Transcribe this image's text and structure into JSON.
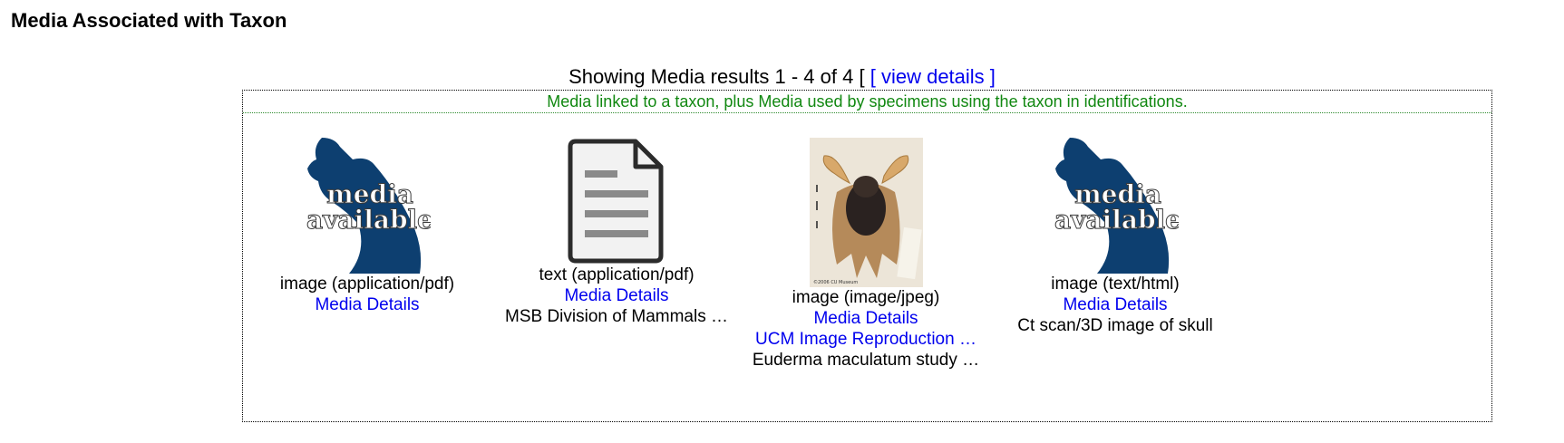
{
  "heading": "Media Associated with Taxon",
  "results": {
    "prefix": "Showing Media results 1 - 4 of 4",
    "bracket_open": "[",
    "view_details": "[ view details ]"
  },
  "note": "Media linked to a taxon, plus Media used by specimens using the taxon in identifications.",
  "items": [
    {
      "thumb_text_1": "media",
      "thumb_text_2": "available",
      "type": "image (application/pdf)",
      "details_link": "Media Details"
    },
    {
      "thumb_icon": "document-icon",
      "type": "text (application/pdf)",
      "details_link": "Media Details",
      "description": "MSB Division of Mammals …"
    },
    {
      "thumb_icon": "bat-specimen-photo",
      "thumb_caption": "©2006 CU Museum",
      "type": "image (image/jpeg)",
      "details_link": "Media Details",
      "extra_link": "UCM Image Reproduction …",
      "description": "Euderma maculatum study …"
    },
    {
      "thumb_text_1": "media",
      "thumb_text_2": "available",
      "type": "image (text/html)",
      "details_link": "Media Details",
      "description": "Ct scan/3D image of skull"
    }
  ],
  "colors": {
    "link": "#0000ee",
    "note": "#118811",
    "bear": "#0d3f70"
  }
}
